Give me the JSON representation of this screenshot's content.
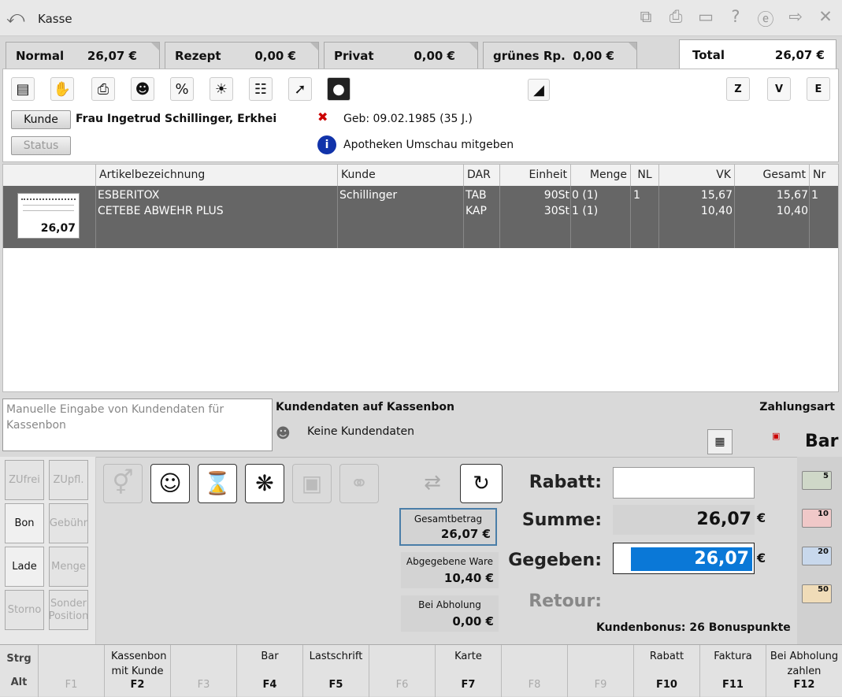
{
  "window": {
    "title": "Kasse"
  },
  "tabs": [
    {
      "label": "Normal",
      "amount": "26,07 €"
    },
    {
      "label": "Rezept",
      "amount": "0,00 €"
    },
    {
      "label": "Privat",
      "amount": "0,00 €"
    },
    {
      "label": "grünes Rp.",
      "amount": "0,00 €"
    },
    {
      "label": "Total",
      "amount": "26,07 €"
    }
  ],
  "customer": {
    "button": "Kunde",
    "status_button": "Status",
    "name": "Frau Ingetrud Schillinger, Erkhei",
    "birth": "Geb: 09.02.1985 (35 J.)",
    "info": "Apotheken Umschau mitgeben",
    "letters": [
      "Z",
      "V",
      "E"
    ]
  },
  "table": {
    "headers": [
      "Artikelbezeichnung",
      "Kunde",
      "DAR",
      "Einheit",
      "Menge",
      "NL",
      "VK",
      "Gesamt",
      "Nr"
    ],
    "receipt_total": "26,07",
    "rows": [
      {
        "artikel": "ESBERITOX",
        "kunde": "Schillinger",
        "dar": "TAB",
        "einheit": "90St",
        "menge": "0 (1)",
        "nl": "1",
        "vk": "15,67",
        "gesamt": "15,67",
        "nr": "1"
      },
      {
        "artikel": "CETEBE ABWEHR PLUS",
        "kunde": "",
        "dar": "KAP",
        "einheit": "30St",
        "menge": "1 (1)",
        "nl": "",
        "vk": "10,40",
        "gesamt": "10,40",
        "nr": ""
      }
    ]
  },
  "bon": {
    "manual_placeholder": "Manuelle Eingabe von Kundendaten für Kassenbon",
    "heading": "Kundendaten auf Kassenbon",
    "value": "Keine Kundendaten"
  },
  "payment": {
    "heading": "Zahlungsart",
    "method": "Bar"
  },
  "side_buttons": [
    {
      "label": "ZUfrei",
      "active": false
    },
    {
      "label": "ZUpfl.",
      "active": false
    },
    {
      "label": "Bon",
      "active": true
    },
    {
      "label": "Gebühr",
      "active": false
    },
    {
      "label": "Lade",
      "active": true
    },
    {
      "label": "Menge",
      "active": false
    },
    {
      "label": "Storno",
      "active": false
    },
    {
      "label": "Sonder Position",
      "active": false
    }
  ],
  "amounts": [
    {
      "label": "Gesamtbetrag",
      "value": "26,07 €"
    },
    {
      "label": "Abgegebene Ware",
      "value": "10,40 €"
    },
    {
      "label": "Bei Abholung",
      "value": "0,00 €"
    }
  ],
  "totals": {
    "rabatt_label": "Rabatt:",
    "summe_label": "Summe:",
    "summe": "26,07",
    "gegeben_label": "Gegeben:",
    "gegeben": "26,07",
    "retour_label": "Retour:",
    "currency": "€",
    "bonus": "Kundenbonus: 26 Bonuspunkte"
  },
  "money": [
    "5",
    "10",
    "20",
    "50"
  ],
  "fkeys": {
    "mods": [
      "Strg",
      "Alt"
    ],
    "keys": [
      {
        "label": "",
        "key": "F1"
      },
      {
        "label": "Kassenbon mit Kunde",
        "key": "F2"
      },
      {
        "label": "",
        "key": "F3"
      },
      {
        "label": "Bar",
        "key": "F4"
      },
      {
        "label": "Lastschrift",
        "key": "F5"
      },
      {
        "label": "",
        "key": "F6"
      },
      {
        "label": "Karte",
        "key": "F7"
      },
      {
        "label": "",
        "key": "F8"
      },
      {
        "label": "",
        "key": "F9"
      },
      {
        "label": "Rabatt",
        "key": "F10"
      },
      {
        "label": "Faktura",
        "key": "F11"
      },
      {
        "label": "Bei Abholung zahlen",
        "key": "F12"
      }
    ]
  },
  "colors": {
    "selected_row": "#666666",
    "input_highlight": "#0a78d7"
  }
}
